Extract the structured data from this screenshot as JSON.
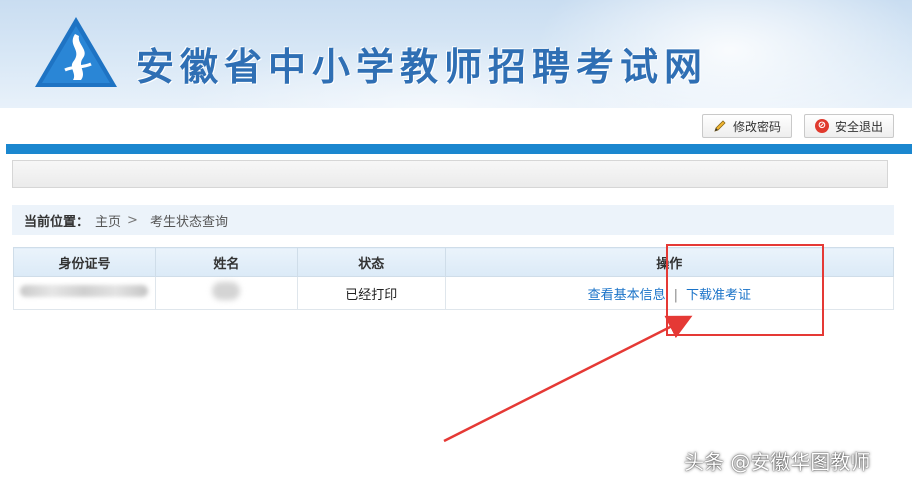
{
  "header": {
    "site_title": "安徽省中小学教师招聘考试网",
    "logo_icon": "flame-triangle-logo-icon"
  },
  "toolbar": {
    "change_password_label": "修改密码",
    "change_password_icon": "pencil-icon",
    "logout_label": "安全退出",
    "logout_icon": "stop-icon"
  },
  "breadcrumb": {
    "label": "当前位置：",
    "home": "主页",
    "separator": ">",
    "current": "考生状态查询"
  },
  "table": {
    "columns": [
      "身份证号",
      "姓名",
      "状态",
      "操作"
    ],
    "rows": [
      {
        "id_number": "",
        "name": "",
        "status": "已经打印",
        "actions": [
          "查看基本信息",
          "下载准考证"
        ],
        "action_separator": "|"
      }
    ]
  },
  "annotation": {
    "highlight_color": "#e53935"
  },
  "watermark": {
    "text": "头条 @安徽华图教师"
  },
  "colors": {
    "accent_blue": "#1b87cf",
    "title_blue": "#2f6fb4",
    "link_blue": "#1a73c8"
  }
}
